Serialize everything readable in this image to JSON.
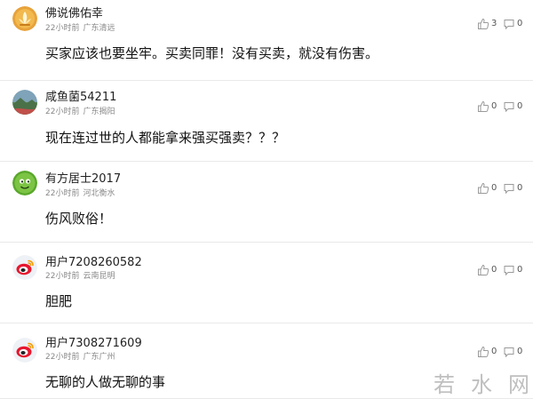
{
  "comments": [
    {
      "avatar": "orange-lotus-avatar",
      "username": "佛说佛佑幸",
      "time": "22小时前",
      "location": "广东清远",
      "text": "买家应该也要坐牢。买卖同罪！没有买卖，就没有伤害。",
      "likes": "3",
      "replies": "0"
    },
    {
      "avatar": "landscape-avatar",
      "username": "咸鱼菌54211",
      "time": "22小时前",
      "location": "广东揭阳",
      "text": "现在连过世的人都能拿来强买强卖？？？",
      "likes": "0",
      "replies": "0"
    },
    {
      "avatar": "green-character-avatar",
      "username": "有方居士2017",
      "time": "22小时前",
      "location": "河北衡水",
      "text": "伤风败俗！",
      "likes": "0",
      "replies": "0"
    },
    {
      "avatar": "weibo-default-avatar",
      "username": "用户7208260582",
      "time": "22小时前",
      "location": "云南昆明",
      "text": "胆肥",
      "likes": "0",
      "replies": "0"
    },
    {
      "avatar": "weibo-default-avatar",
      "username": "用户7308271609",
      "time": "22小时前",
      "location": "广东广州",
      "text": "无聊的人做无聊的事",
      "likes": "0",
      "replies": "0"
    }
  ],
  "watermark": {
    "chars": [
      "若",
      "水",
      "网"
    ]
  },
  "colors": {
    "text": "#111111",
    "meta": "#888888",
    "divider": "#e9e9e9",
    "icon": "#9a9a9a",
    "watermark": "#bfbfbf"
  }
}
